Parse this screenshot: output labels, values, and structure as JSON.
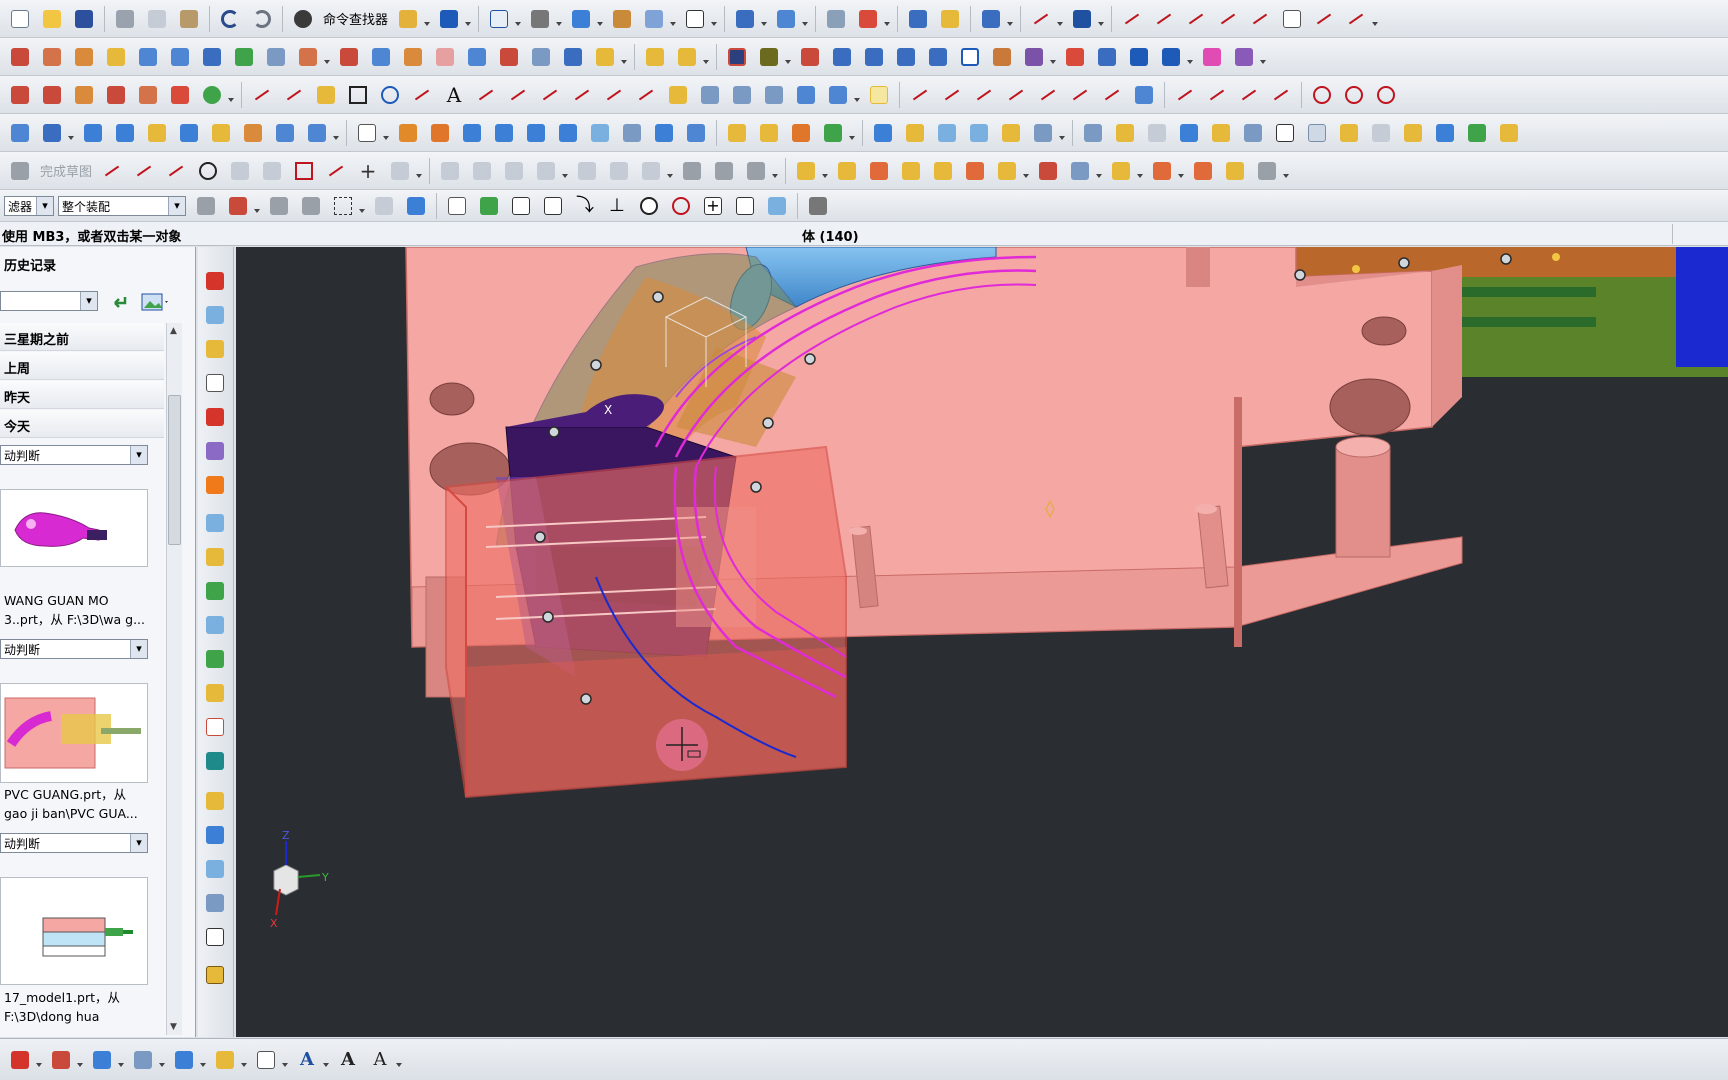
{
  "toolbar": {
    "command_finder_label": "命令查找器",
    "sketch_label": "完成草图",
    "filter_label": "滤器",
    "assembly_scope_value": "整个装配"
  },
  "cue_line": {
    "prompt": "使用 MB3，或者双击某一对象",
    "status": "体 (140)"
  },
  "history": {
    "title": "历史记录",
    "sections": [
      "三星期之前",
      "上周",
      "昨天",
      "今天"
    ],
    "entries": [
      {
        "combo": "动判断",
        "lines": [
          "WANG GUAN MO",
          "3..prt，从 F:\\3D\\wa g..."
        ]
      },
      {
        "combo": "动判断",
        "lines": [
          "PVC GUANG.prt，从",
          "gao ji ban\\PVC GUA..."
        ]
      },
      {
        "combo": "动判断",
        "lines": [
          "17_model1.prt，从",
          "F:\\3D\\dong hua"
        ]
      }
    ]
  },
  "viewport": {
    "triad": {
      "z": "Z",
      "y": "Y",
      "x": "X"
    },
    "csys_label": "X"
  },
  "colors": {
    "viewport_bg": "#2a2d32",
    "mold_plate": "#f4a7a3",
    "insert_box": "#ee6e64",
    "slider": "#3a1560",
    "pipe": "#5aa3df",
    "curves": "#e02ad8"
  }
}
